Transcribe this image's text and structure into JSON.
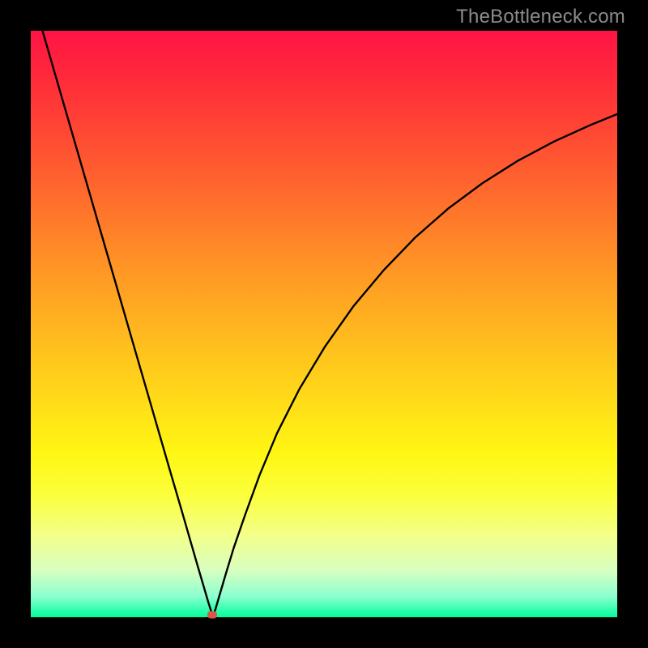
{
  "watermark": "TheBottleneck.com",
  "colors": {
    "frame": "#000000",
    "watermark": "#8b8b8b",
    "curve": "#000000",
    "marker": "#d9564a"
  },
  "chart_data": {
    "type": "line",
    "title": "",
    "xlabel": "",
    "ylabel": "",
    "xlim": [
      0,
      1
    ],
    "ylim": [
      0,
      1
    ],
    "x": [
      0.02,
      0.04,
      0.06,
      0.08,
      0.1,
      0.12,
      0.14,
      0.16,
      0.18,
      0.2,
      0.22,
      0.24,
      0.257,
      0.272,
      0.285,
      0.295,
      0.302,
      0.307,
      0.31,
      0.315,
      0.322,
      0.332,
      0.346,
      0.366,
      0.39,
      0.42,
      0.458,
      0.502,
      0.55,
      0.602,
      0.656,
      0.712,
      0.77,
      0.83,
      0.892,
      0.956,
      1.0
    ],
    "y": [
      1.0,
      0.931,
      0.862,
      0.793,
      0.724,
      0.655,
      0.586,
      0.517,
      0.448,
      0.379,
      0.31,
      0.241,
      0.183,
      0.131,
      0.086,
      0.052,
      0.028,
      0.012,
      0.0,
      0.014,
      0.038,
      0.072,
      0.118,
      0.176,
      0.242,
      0.314,
      0.389,
      0.462,
      0.53,
      0.592,
      0.648,
      0.697,
      0.74,
      0.778,
      0.811,
      0.84,
      0.858
    ],
    "marker": {
      "x": 0.31,
      "y": 0.004
    }
  }
}
